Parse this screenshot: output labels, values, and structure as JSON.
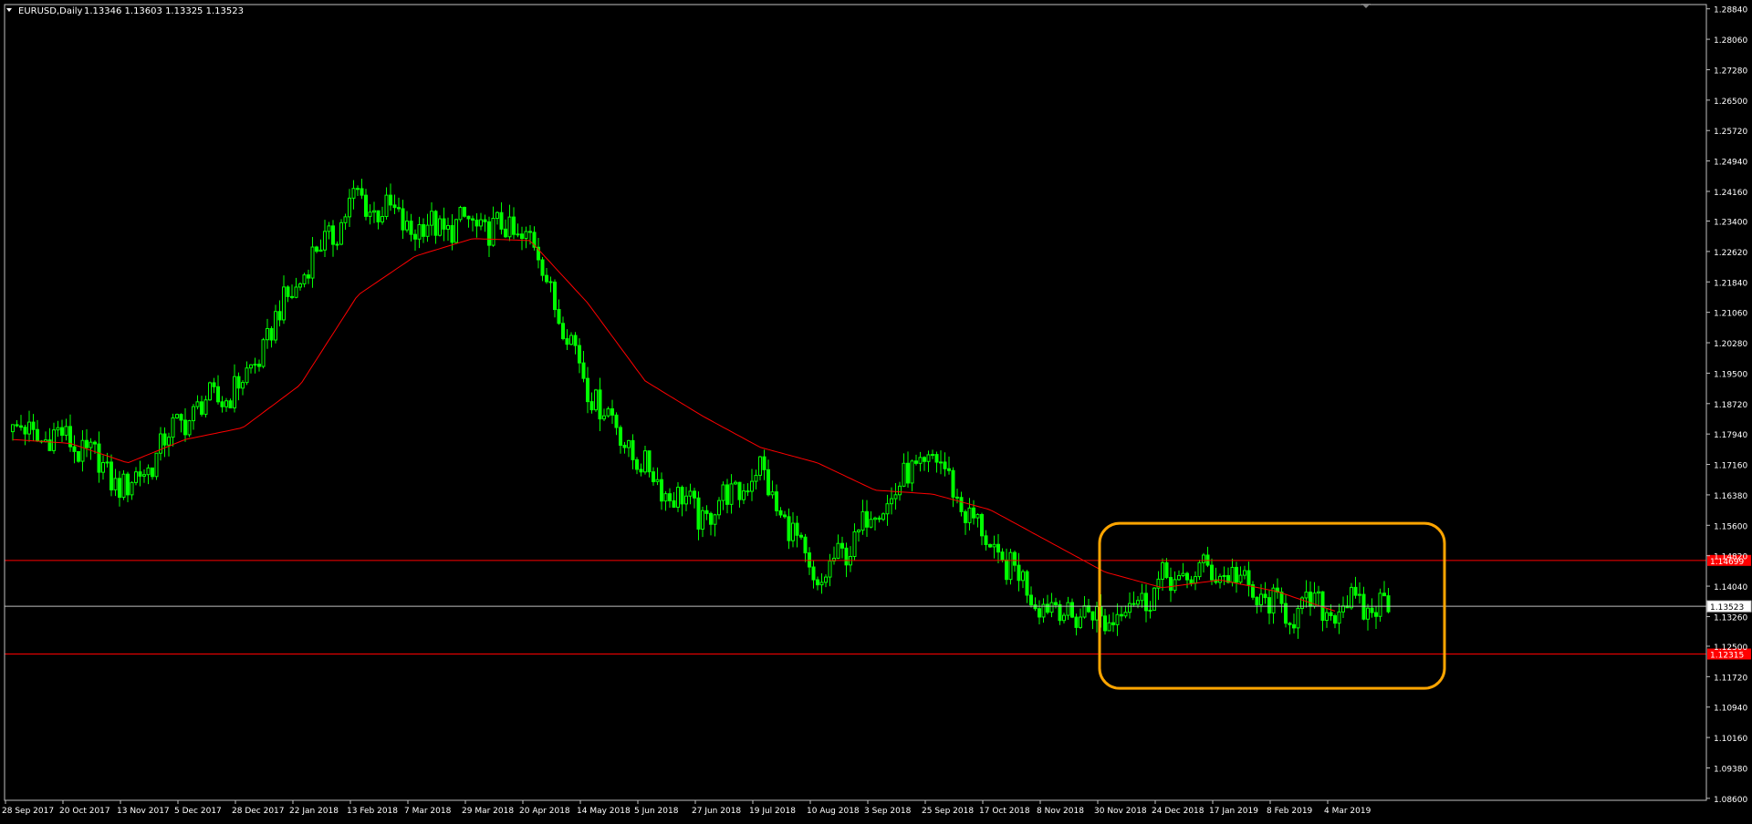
{
  "header": {
    "symbol": "EURUSD,Daily",
    "ohlc": "1.13346 1.13603 1.13325 1.13523"
  },
  "colors": {
    "background": "#000000",
    "frame": "#c0c0c0",
    "candle": "#00ff00",
    "moving_average": "#ff0000",
    "level_lines": "#ff0000",
    "price_line": "#c0c0c0",
    "highlight_box": "#ffa500",
    "price_label_text": "#ffffff"
  },
  "chart_data": {
    "type": "candlestick",
    "instrument": "EURUSD",
    "timeframe": "Daily",
    "x_tick_labels": [
      "28 Sep 2017",
      "20 Oct 2017",
      "13 Nov 2017",
      "5 Dec 2017",
      "28 Dec 2017",
      "22 Jan 2018",
      "13 Feb 2018",
      "7 Mar 2018",
      "29 Mar 2018",
      "20 Apr 2018",
      "14 May 2018",
      "5 Jun 2018",
      "27 Jun 2018",
      "19 Jul 2018",
      "10 Aug 2018",
      "3 Sep 2018",
      "25 Sep 2018",
      "17 Oct 2018",
      "8 Nov 2018",
      "30 Nov 2018",
      "24 Dec 2018",
      "17 Jan 2019",
      "8 Feb 2019",
      "4 Mar 2019"
    ],
    "y_tick_labels": [
      "1.28840",
      "1.28060",
      "1.27280",
      "1.26500",
      "1.25720",
      "1.24940",
      "1.24160",
      "1.23400",
      "1.22620",
      "1.21840",
      "1.21060",
      "1.20280",
      "1.19500",
      "1.18720",
      "1.17940",
      "1.17160",
      "1.16380",
      "1.15600",
      "1.14820",
      "1.14040",
      "1.13260",
      "1.12500",
      "1.11720",
      "1.10940",
      "1.10160",
      "1.09380",
      "1.08600"
    ],
    "ylim": [
      1.0855,
      1.2895
    ],
    "close_series": [
      {
        "period": "28 Sep 2017",
        "close": 1.18
      },
      {
        "period": "20 Oct 2017",
        "close": 1.178
      },
      {
        "period": "13 Nov 2017",
        "close": 1.165
      },
      {
        "period": "5 Dec 2017",
        "close": 1.184
      },
      {
        "period": "28 Dec 2017",
        "close": 1.192
      },
      {
        "period": "22 Jan 2018",
        "close": 1.22
      },
      {
        "period": "13 Feb 2018",
        "close": 1.24
      },
      {
        "period": "7 Mar 2018",
        "close": 1.232
      },
      {
        "period": "29 Mar 2018",
        "close": 1.233
      },
      {
        "period": "20 Apr 2018",
        "close": 1.23
      },
      {
        "period": "14 May 2018",
        "close": 1.192
      },
      {
        "period": "5 Jun 2018",
        "close": 1.17
      },
      {
        "period": "27 Jun 2018",
        "close": 1.158
      },
      {
        "period": "19 Jul 2018",
        "close": 1.17
      },
      {
        "period": "10 Aug 2018",
        "close": 1.14
      },
      {
        "period": "3 Sep 2018",
        "close": 1.16
      },
      {
        "period": "25 Sep 2018",
        "close": 1.174
      },
      {
        "period": "17 Oct 2018",
        "close": 1.15
      },
      {
        "period": "8 Nov 2018",
        "close": 1.135
      },
      {
        "period": "30 Nov 2018",
        "close": 1.132
      },
      {
        "period": "24 Dec 2018",
        "close": 1.141
      },
      {
        "period": "17 Jan 2019",
        "close": 1.145
      },
      {
        "period": "8 Feb 2019",
        "close": 1.134
      },
      {
        "period": "4 Mar 2019",
        "close": 1.1352
      }
    ],
    "moving_average": [
      {
        "period": "28 Sep 2017",
        "value": 1.178
      },
      {
        "period": "20 Oct 2017",
        "value": 1.177
      },
      {
        "period": "13 Nov 2017",
        "value": 1.172
      },
      {
        "period": "5 Dec 2017",
        "value": 1.178
      },
      {
        "period": "28 Dec 2017",
        "value": 1.181
      },
      {
        "period": "22 Jan 2018",
        "value": 1.192
      },
      {
        "period": "13 Feb 2018",
        "value": 1.215
      },
      {
        "period": "7 Mar 2018",
        "value": 1.225
      },
      {
        "period": "29 Mar 2018",
        "value": 1.2295
      },
      {
        "period": "20 Apr 2018",
        "value": 1.229
      },
      {
        "period": "14 May 2018",
        "value": 1.213
      },
      {
        "period": "5 Jun 2018",
        "value": 1.193
      },
      {
        "period": "27 Jun 2018",
        "value": 1.184
      },
      {
        "period": "19 Jul 2018",
        "value": 1.176
      },
      {
        "period": "10 Aug 2018",
        "value": 1.172
      },
      {
        "period": "3 Sep 2018",
        "value": 1.165
      },
      {
        "period": "25 Sep 2018",
        "value": 1.164
      },
      {
        "period": "17 Oct 2018",
        "value": 1.16
      },
      {
        "period": "8 Nov 2018",
        "value": 1.152
      },
      {
        "period": "30 Nov 2018",
        "value": 1.144
      },
      {
        "period": "24 Dec 2018",
        "value": 1.14
      },
      {
        "period": "17 Jan 2019",
        "value": 1.142
      },
      {
        "period": "8 Feb 2019",
        "value": 1.139
      },
      {
        "period": "4 Mar 2019",
        "value": 1.134
      }
    ],
    "horizontal_levels": [
      {
        "price": 1.147,
        "label": "1.14699"
      },
      {
        "price": 1.123,
        "label": "1.12315"
      }
    ],
    "current_price": {
      "price": 1.13523,
      "label": "1.13523"
    },
    "highlight_box": {
      "from_period": "30 Nov 2018",
      "to_period": "4 Mar 2019",
      "price_top": 1.1565,
      "price_bottom": 1.1142
    },
    "grid": false
  }
}
